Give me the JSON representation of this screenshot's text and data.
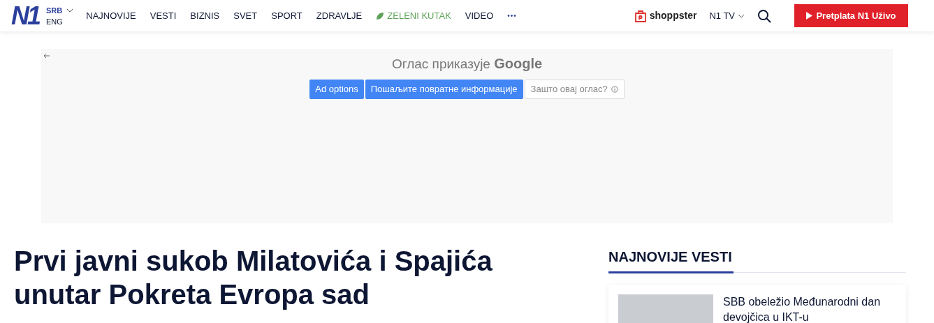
{
  "header": {
    "logo": "N1",
    "languages": [
      {
        "label": "SRB",
        "selected": true
      },
      {
        "label": "ENG",
        "selected": false
      }
    ],
    "nav": [
      {
        "label": "NAJNOVIJE",
        "kind": "plain"
      },
      {
        "label": "VESTI",
        "kind": "plain"
      },
      {
        "label": "BIZNIS",
        "kind": "plain"
      },
      {
        "label": "SVET",
        "kind": "plain"
      },
      {
        "label": "SPORT",
        "kind": "plain"
      },
      {
        "label": "ZDRAVLJE",
        "kind": "plain"
      },
      {
        "label": "ZELENI KUTAK",
        "kind": "green"
      },
      {
        "label": "VIDEO",
        "kind": "plain"
      }
    ],
    "more": "•••",
    "shop": "shoppster",
    "tv": "N1 TV",
    "subscribe": "Pretplata N1 Uživo"
  },
  "ad": {
    "title": "Оглас приказује",
    "brand": "Google",
    "buttons": [
      {
        "label": "Ad options",
        "kind": "primary"
      },
      {
        "label": "Пошаљите повратне информације",
        "kind": "primary"
      },
      {
        "label": "Зашто овај оглас?",
        "kind": "secondary"
      }
    ]
  },
  "article": {
    "headline": "Prvi javni sukob Milatovića i Spajića unutar Pokreta Evropa sad"
  },
  "sidebar": {
    "title": "NAJNOVIJE VESTI",
    "items": [
      {
        "title": "SBB obeležio Međunarodni dan devojčica u IKT-u"
      }
    ]
  }
}
